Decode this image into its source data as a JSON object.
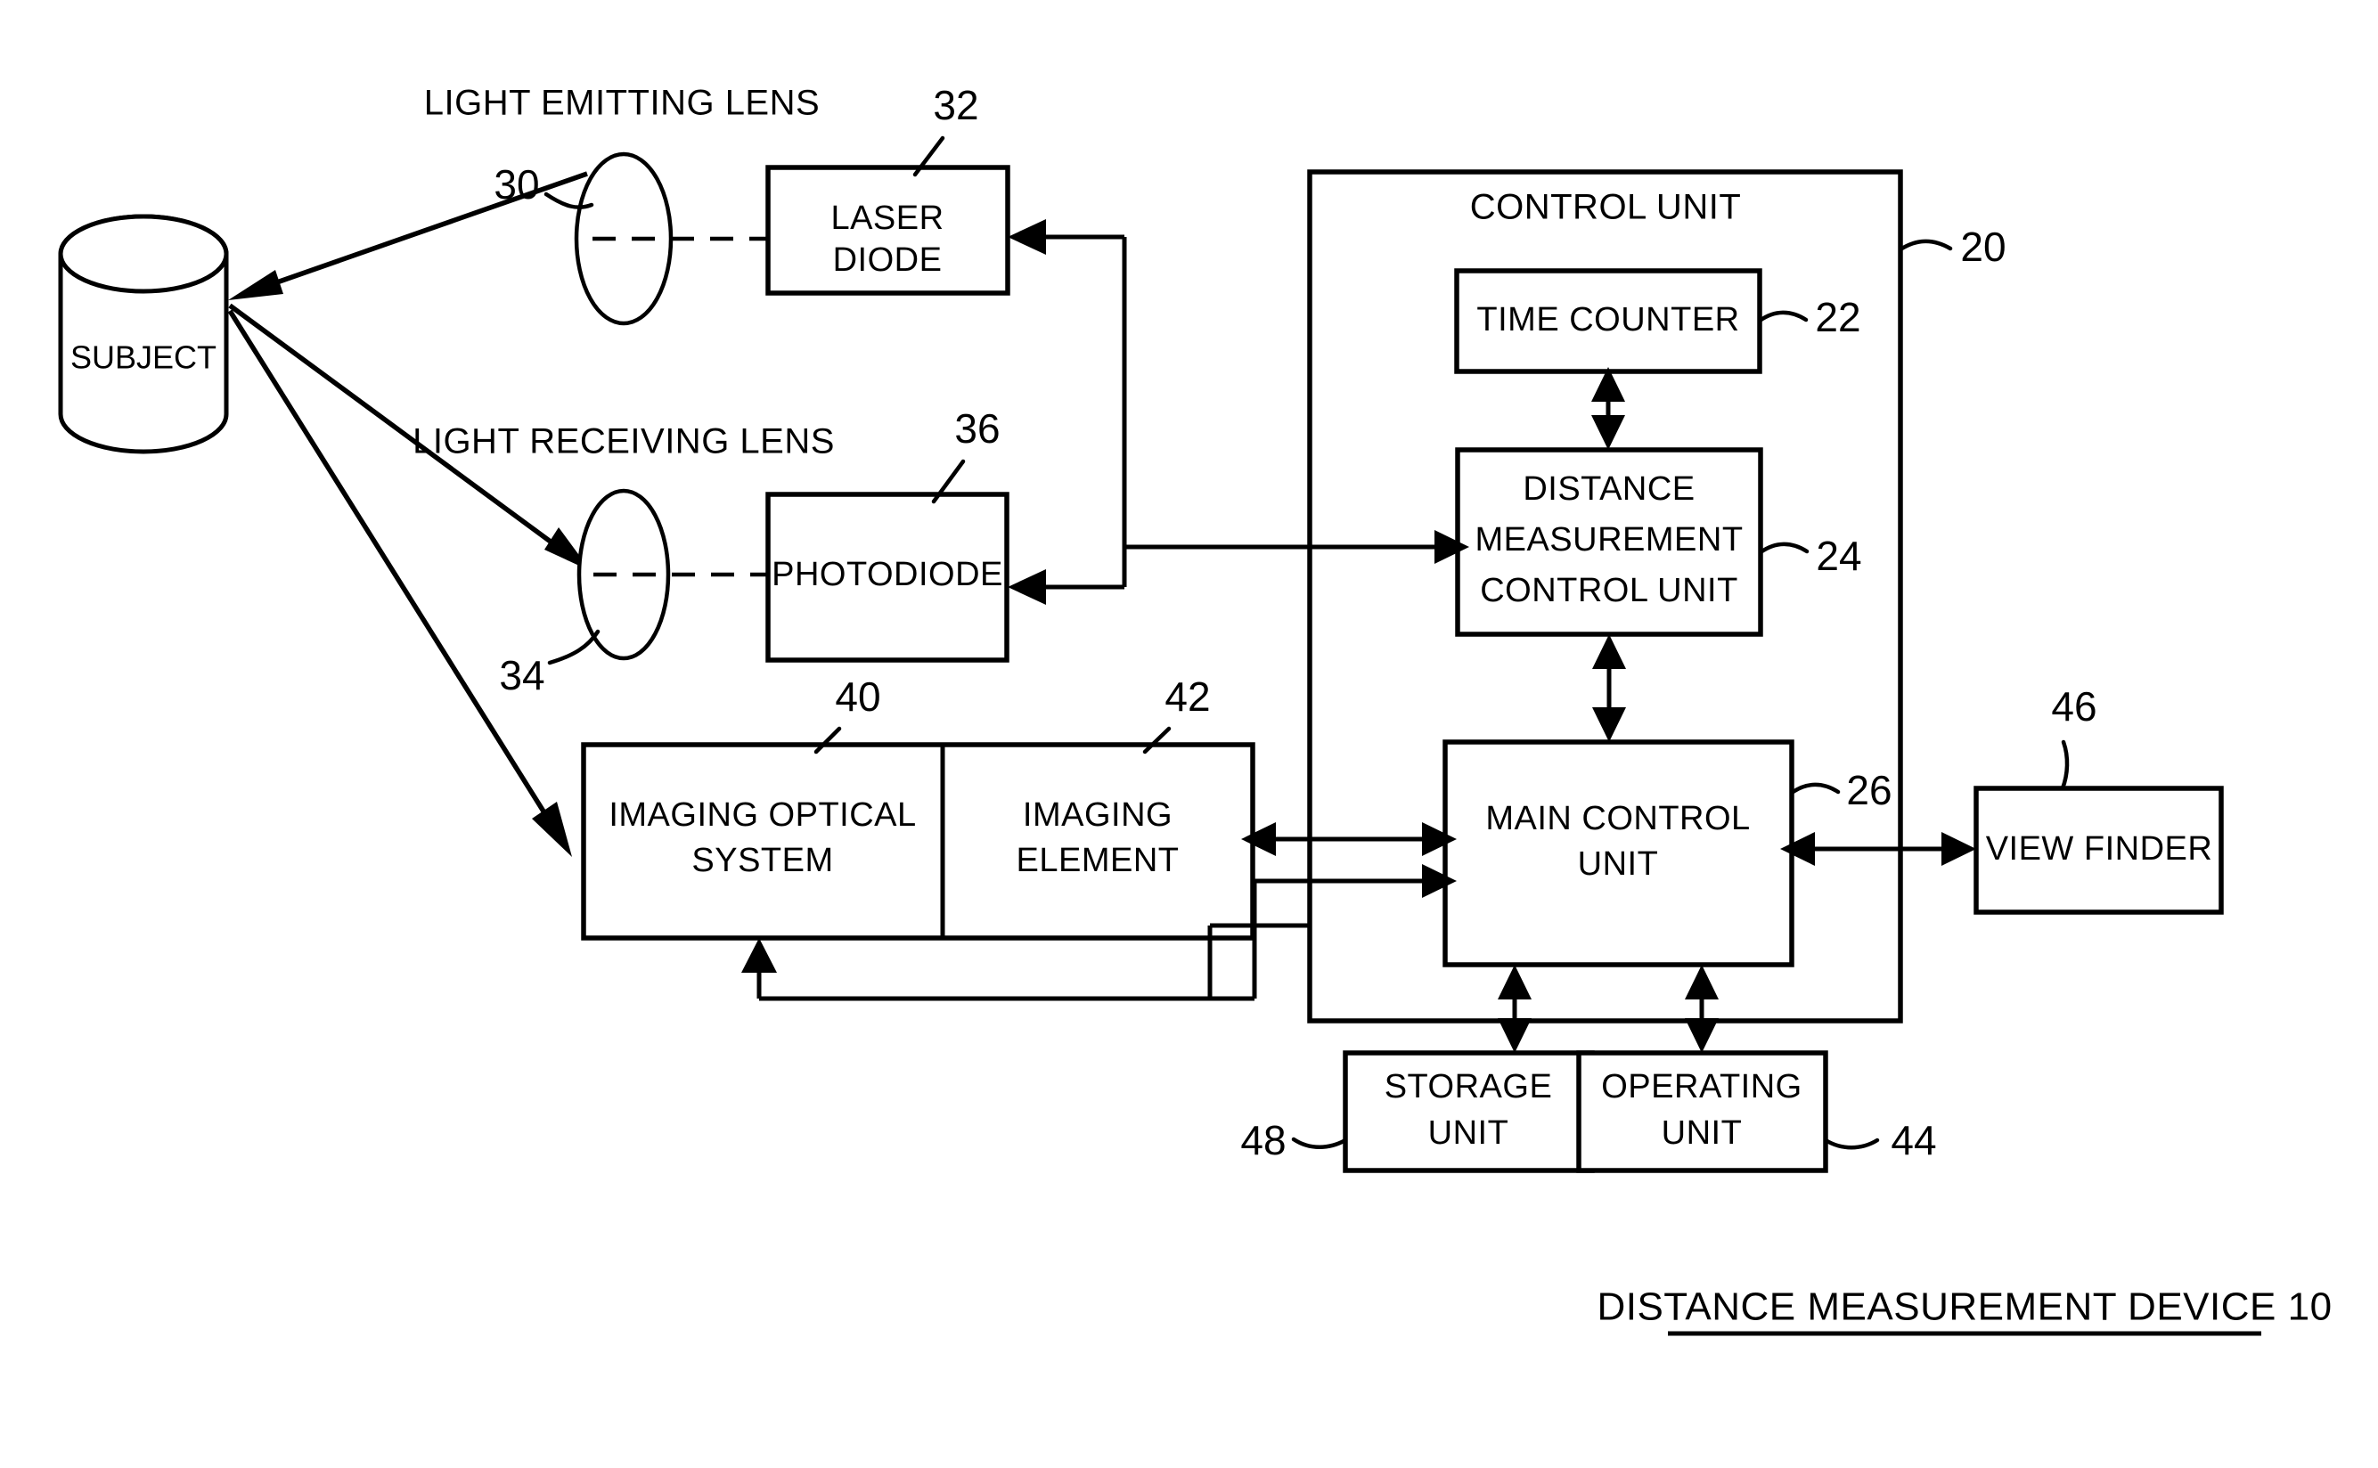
{
  "figure": {
    "caption": "DISTANCE MEASUREMENT DEVICE 10",
    "caption_underlined": true,
    "line_color": "#000000",
    "background_color": "#ffffff"
  },
  "labels": {
    "light_emitting_lens": "LIGHT EMITTING LENS",
    "light_receiving_lens": "LIGHT RECEIVING LENS",
    "control_unit": "CONTROL UNIT"
  },
  "nodes": {
    "subject": {
      "label": "SUBJECT",
      "ref": ""
    },
    "emitting_lens": {
      "label": "",
      "ref": "30"
    },
    "laser_diode": {
      "label_line1": "LASER",
      "label_line2": "DIODE",
      "ref": "32"
    },
    "receiving_lens": {
      "label": "",
      "ref": "34"
    },
    "photodiode": {
      "label": "PHOTODIODE",
      "ref": "36"
    },
    "imaging_optical_system": {
      "label_line1": "IMAGING OPTICAL",
      "label_line2": "SYSTEM",
      "ref": "40"
    },
    "imaging_element": {
      "label_line1": "IMAGING",
      "label_line2": "ELEMENT",
      "ref": "42"
    },
    "control_unit": {
      "label": "CONTROL UNIT",
      "ref": "20"
    },
    "time_counter": {
      "label": "TIME COUNTER",
      "ref": "22"
    },
    "distance_measurement_control_unit": {
      "label_line1": "DISTANCE",
      "label_line2": "MEASUREMENT",
      "label_line3": "CONTROL UNIT",
      "ref": "24"
    },
    "main_control_unit": {
      "label_line1": "MAIN CONTROL",
      "label_line2": "UNIT",
      "ref": "26"
    },
    "view_finder": {
      "label": "VIEW FINDER",
      "ref": "46"
    },
    "storage_unit": {
      "label_line1": "STORAGE",
      "label_line2": "UNIT",
      "ref": "48"
    },
    "operating_unit": {
      "label_line1": "OPERATING",
      "label_line2": "UNIT",
      "ref": "44"
    }
  },
  "chart_data": {
    "type": "diagram",
    "title": "DISTANCE MEASUREMENT DEVICE 10",
    "blocks": [
      {
        "id": "subject",
        "text": "SUBJECT",
        "ref": null,
        "shape": "cylinder"
      },
      {
        "id": "emitting-lens",
        "text": "LIGHT EMITTING LENS",
        "ref": "30",
        "shape": "lens"
      },
      {
        "id": "laser-diode",
        "text": "LASER DIODE",
        "ref": "32",
        "shape": "rect"
      },
      {
        "id": "receiving-lens",
        "text": "LIGHT RECEIVING LENS",
        "ref": "34",
        "shape": "lens"
      },
      {
        "id": "photodiode",
        "text": "PHOTODIODE",
        "ref": "36",
        "shape": "rect"
      },
      {
        "id": "imaging-optical-system",
        "text": "IMAGING OPTICAL SYSTEM",
        "ref": "40",
        "shape": "rect"
      },
      {
        "id": "imaging-element",
        "text": "IMAGING ELEMENT",
        "ref": "42",
        "shape": "rect"
      },
      {
        "id": "control-unit",
        "text": "CONTROL UNIT",
        "ref": "20",
        "shape": "container"
      },
      {
        "id": "time-counter",
        "text": "TIME COUNTER",
        "ref": "22",
        "shape": "rect"
      },
      {
        "id": "distance-measurement-control-unit",
        "text": "DISTANCE MEASUREMENT CONTROL UNIT",
        "ref": "24",
        "shape": "rect"
      },
      {
        "id": "main-control-unit",
        "text": "MAIN CONTROL UNIT",
        "ref": "26",
        "shape": "rect"
      },
      {
        "id": "view-finder",
        "text": "VIEW FINDER",
        "ref": "46",
        "shape": "rect"
      },
      {
        "id": "storage-unit",
        "text": "STORAGE UNIT",
        "ref": "48",
        "shape": "rect"
      },
      {
        "id": "operating-unit",
        "text": "OPERATING UNIT",
        "ref": "44",
        "shape": "rect"
      }
    ],
    "edges": [
      {
        "from": "emitting-lens",
        "to": "subject",
        "style": "solid",
        "arrow": "single"
      },
      {
        "from": "emitting-lens",
        "to": "laser-diode",
        "style": "dashed",
        "arrow": "none"
      },
      {
        "from": "subject",
        "to": "receiving-lens",
        "style": "solid",
        "arrow": "single"
      },
      {
        "from": "receiving-lens",
        "to": "photodiode",
        "style": "dashed",
        "arrow": "none"
      },
      {
        "from": "subject",
        "to": "imaging-optical-system",
        "style": "solid",
        "arrow": "single"
      },
      {
        "from": "distance-measurement-control-unit",
        "to": "laser-diode",
        "style": "solid",
        "arrow": "single"
      },
      {
        "from": "distance-measurement-control-unit",
        "to": "photodiode",
        "style": "solid",
        "arrow": "single"
      },
      {
        "from": "photodiode",
        "to": "distance-measurement-control-unit",
        "style": "solid",
        "arrow": "single"
      },
      {
        "from": "time-counter",
        "to": "distance-measurement-control-unit",
        "style": "solid",
        "arrow": "double"
      },
      {
        "from": "distance-measurement-control-unit",
        "to": "main-control-unit",
        "style": "solid",
        "arrow": "double"
      },
      {
        "from": "imaging-element",
        "to": "main-control-unit",
        "style": "solid",
        "arrow": "double"
      },
      {
        "from": "imaging-element",
        "to": "main-control-unit",
        "style": "solid",
        "arrow": "single"
      },
      {
        "from": "main-control-unit",
        "to": "imaging-optical-system",
        "style": "solid",
        "arrow": "single"
      },
      {
        "from": "main-control-unit",
        "to": "view-finder",
        "style": "solid",
        "arrow": "double"
      },
      {
        "from": "main-control-unit",
        "to": "storage-unit",
        "style": "solid",
        "arrow": "double"
      },
      {
        "from": "main-control-unit",
        "to": "operating-unit",
        "style": "solid",
        "arrow": "double"
      }
    ]
  }
}
